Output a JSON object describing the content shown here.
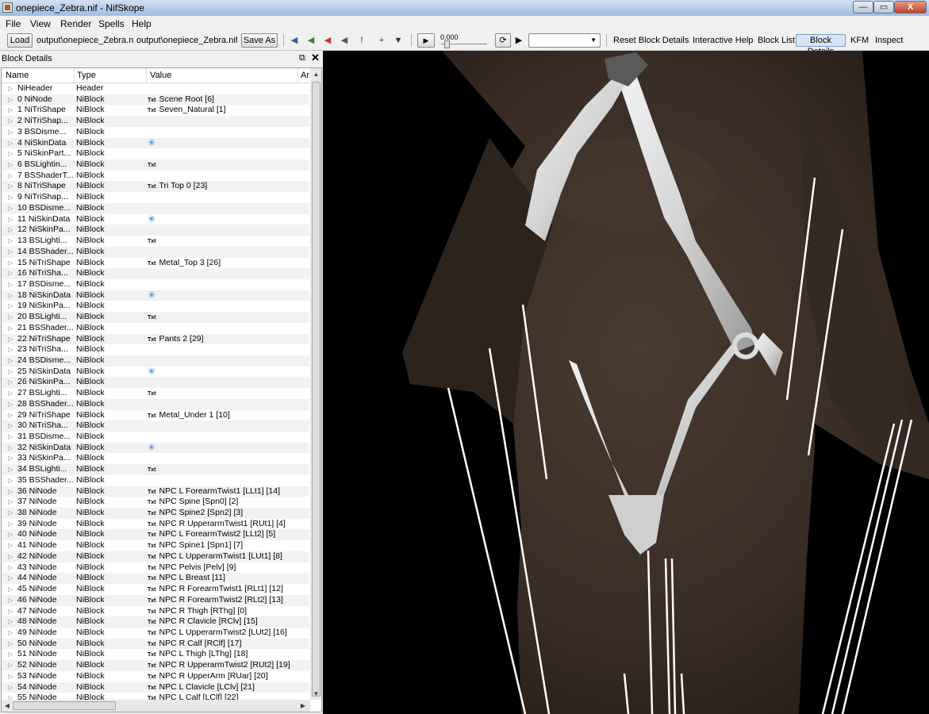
{
  "window": {
    "title": "onepiece_Zebra.nif - NifSkope",
    "min": "—",
    "max": "▭",
    "close": "X"
  },
  "menu": {
    "file": "File",
    "view": "View",
    "render": "Render",
    "spells": "Spells",
    "help": "Help"
  },
  "toolbar": {
    "load": "Load",
    "load_path": "output\\onepiece_Zebra.nif",
    "save_path": "output\\onepiece_Zebra.nif",
    "save_as": "Save As",
    "time_value": "0.000",
    "reset_block_details": "Reset Block Details",
    "interactive_help": "Interactive Help",
    "block_list": "Block List",
    "block_details": "Block Details",
    "kfm": "KFM",
    "inspect": "Inspect"
  },
  "dock": {
    "title": "Block Details",
    "float_icon": "float-icon",
    "close": "✕",
    "columns": {
      "name": "Name",
      "type": "Type",
      "value": "Value",
      "extra": "Ar"
    },
    "rows": [
      {
        "name": "NiHeader",
        "type": "Header",
        "value": "",
        "tag": ""
      },
      {
        "name": "0 NiNode",
        "type": "NiBlock",
        "value": "Scene Root [6]",
        "tag": "Txt"
      },
      {
        "name": "1 NiTriShape",
        "type": "NiBlock",
        "value": "Seven_Natural [1]",
        "tag": "Txt"
      },
      {
        "name": "2 NiTriShap...",
        "type": "NiBlock",
        "value": "",
        "tag": ""
      },
      {
        "name": "3 BSDisme...",
        "type": "NiBlock",
        "value": "",
        "tag": ""
      },
      {
        "name": "4 NiSkinData",
        "type": "NiBlock",
        "value": "",
        "tag": "star"
      },
      {
        "name": "5 NiSkinPart...",
        "type": "NiBlock",
        "value": "",
        "tag": ""
      },
      {
        "name": "6 BSLightin...",
        "type": "NiBlock",
        "value": "",
        "tag": "Txt"
      },
      {
        "name": "7 BSShaderT...",
        "type": "NiBlock",
        "value": "",
        "tag": ""
      },
      {
        "name": "8 NiTriShape",
        "type": "NiBlock",
        "value": "Tri Top 0 [23]",
        "tag": "Txt"
      },
      {
        "name": "9 NiTriShap...",
        "type": "NiBlock",
        "value": "",
        "tag": ""
      },
      {
        "name": "10 BSDisme...",
        "type": "NiBlock",
        "value": "",
        "tag": ""
      },
      {
        "name": "11 NiSkinData",
        "type": "NiBlock",
        "value": "",
        "tag": "star"
      },
      {
        "name": "12 NiSkinPa...",
        "type": "NiBlock",
        "value": "",
        "tag": ""
      },
      {
        "name": "13 BSLighti...",
        "type": "NiBlock",
        "value": "",
        "tag": "Txt"
      },
      {
        "name": "14 BSShader...",
        "type": "NiBlock",
        "value": "",
        "tag": ""
      },
      {
        "name": "15 NiTriShape",
        "type": "NiBlock",
        "value": "Metal_Top 3 [26]",
        "tag": "Txt"
      },
      {
        "name": "16 NiTriSha...",
        "type": "NiBlock",
        "value": "",
        "tag": ""
      },
      {
        "name": "17 BSDisme...",
        "type": "NiBlock",
        "value": "",
        "tag": ""
      },
      {
        "name": "18 NiSkinData",
        "type": "NiBlock",
        "value": "",
        "tag": "star"
      },
      {
        "name": "19 NiSkinPa...",
        "type": "NiBlock",
        "value": "",
        "tag": ""
      },
      {
        "name": "20 BSLighti...",
        "type": "NiBlock",
        "value": "",
        "tag": "Txt"
      },
      {
        "name": "21 BSShader...",
        "type": "NiBlock",
        "value": "",
        "tag": ""
      },
      {
        "name": "22 NiTriShape",
        "type": "NiBlock",
        "value": "Pants 2 [29]",
        "tag": "Txt"
      },
      {
        "name": "23 NiTriSha...",
        "type": "NiBlock",
        "value": "",
        "tag": ""
      },
      {
        "name": "24 BSDisme...",
        "type": "NiBlock",
        "value": "",
        "tag": ""
      },
      {
        "name": "25 NiSkinData",
        "type": "NiBlock",
        "value": "",
        "tag": "star"
      },
      {
        "name": "26 NiSkinPa...",
        "type": "NiBlock",
        "value": "",
        "tag": ""
      },
      {
        "name": "27 BSLighti...",
        "type": "NiBlock",
        "value": "",
        "tag": "Txt"
      },
      {
        "name": "28 BSShader...",
        "type": "NiBlock",
        "value": "",
        "tag": ""
      },
      {
        "name": "29 NiTriShape",
        "type": "NiBlock",
        "value": "Metal_Under 1 [10]",
        "tag": "Txt"
      },
      {
        "name": "30 NiTriSha...",
        "type": "NiBlock",
        "value": "",
        "tag": ""
      },
      {
        "name": "31 BSDisme...",
        "type": "NiBlock",
        "value": "",
        "tag": ""
      },
      {
        "name": "32 NiSkinData",
        "type": "NiBlock",
        "value": "",
        "tag": "star"
      },
      {
        "name": "33 NiSkinPa...",
        "type": "NiBlock",
        "value": "",
        "tag": ""
      },
      {
        "name": "34 BSLighti...",
        "type": "NiBlock",
        "value": "",
        "tag": "Txt"
      },
      {
        "name": "35 BSShader...",
        "type": "NiBlock",
        "value": "",
        "tag": ""
      },
      {
        "name": "36 NiNode",
        "type": "NiBlock",
        "value": "NPC L ForearmTwist1 [LLt1] [14]",
        "tag": "Txt"
      },
      {
        "name": "37 NiNode",
        "type": "NiBlock",
        "value": "NPC Spine [Spn0] [2]",
        "tag": "Txt"
      },
      {
        "name": "38 NiNode",
        "type": "NiBlock",
        "value": "NPC Spine2 [Spn2] [3]",
        "tag": "Txt"
      },
      {
        "name": "39 NiNode",
        "type": "NiBlock",
        "value": "NPC R UpperarmTwist1 [RUt1] [4]",
        "tag": "Txt"
      },
      {
        "name": "40 NiNode",
        "type": "NiBlock",
        "value": "NPC L ForearmTwist2 [LLt2] [5]",
        "tag": "Txt"
      },
      {
        "name": "41 NiNode",
        "type": "NiBlock",
        "value": "NPC Spine1 [Spn1] [7]",
        "tag": "Txt"
      },
      {
        "name": "42 NiNode",
        "type": "NiBlock",
        "value": "NPC L UpperarmTwist1 [LUt1] [8]",
        "tag": "Txt"
      },
      {
        "name": "43 NiNode",
        "type": "NiBlock",
        "value": "NPC Pelvis [Pelv] [9]",
        "tag": "Txt"
      },
      {
        "name": "44 NiNode",
        "type": "NiBlock",
        "value": "NPC L Breast [11]",
        "tag": "Txt"
      },
      {
        "name": "45 NiNode",
        "type": "NiBlock",
        "value": "NPC R ForearmTwist1 [RLt1] [12]",
        "tag": "Txt"
      },
      {
        "name": "46 NiNode",
        "type": "NiBlock",
        "value": "NPC R ForearmTwist2 [RLt2] [13]",
        "tag": "Txt"
      },
      {
        "name": "47 NiNode",
        "type": "NiBlock",
        "value": "NPC R Thigh [RThg] [0]",
        "tag": "Txt"
      },
      {
        "name": "48 NiNode",
        "type": "NiBlock",
        "value": "NPC R Clavicle [RClv] [15]",
        "tag": "Txt"
      },
      {
        "name": "49 NiNode",
        "type": "NiBlock",
        "value": "NPC L UpperarmTwist2 [LUt2] [16]",
        "tag": "Txt"
      },
      {
        "name": "50 NiNode",
        "type": "NiBlock",
        "value": "NPC R Calf [RClf] [17]",
        "tag": "Txt"
      },
      {
        "name": "51 NiNode",
        "type": "NiBlock",
        "value": "NPC L Thigh [LThg] [18]",
        "tag": "Txt"
      },
      {
        "name": "52 NiNode",
        "type": "NiBlock",
        "value": "NPC R UpperarmTwist2 [RUt2] [19]",
        "tag": "Txt"
      },
      {
        "name": "53 NiNode",
        "type": "NiBlock",
        "value": "NPC R UpperArm [RUar] [20]",
        "tag": "Txt"
      },
      {
        "name": "54 NiNode",
        "type": "NiBlock",
        "value": "NPC L Clavicle [LClv] [21]",
        "tag": "Txt"
      },
      {
        "name": "55 NiNode",
        "type": "NiBlock",
        "value": "NPC L Calf [LClf] [22]",
        "tag": "Txt"
      }
    ]
  },
  "colors": {
    "viewport_bg": "#000000",
    "skin": "#3b2e26",
    "garment": "#e6e6e6",
    "bone_lines": "#ffffff"
  }
}
